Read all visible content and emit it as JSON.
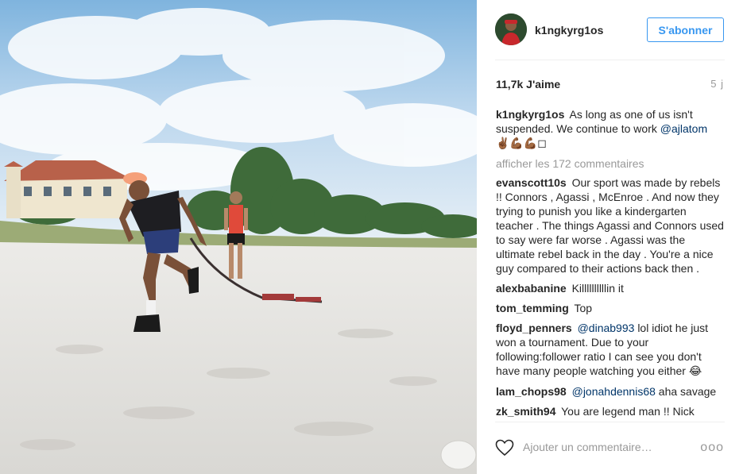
{
  "photo": {
    "alt_icon": "beach-training-photo"
  },
  "header": {
    "username": "k1ngkyrg1os",
    "follow_label": "S'abonner",
    "avatar_icon": "avatar"
  },
  "stats": {
    "likes": "11,7k J'aime",
    "age": "5 j"
  },
  "caption": {
    "author": "k1ngkyrg1os",
    "text": "As long as one of us isn't suspended. We continue to work",
    "mention": "@ajlatom",
    "emojis": "✌🏾💪🏾💪🏾◻"
  },
  "load_more": "afficher les 172 commentaires",
  "comments": [
    {
      "author": "evanscott10s",
      "pre": "",
      "mention": "",
      "text": "Our sport was made by rebels !! Connors , Agassi , McEnroe . And now they trying to punish you like a kindergarten teacher . The things Agassi and Connors used to say were far worse . Agassi was the ultimate rebel back in the day . You're a nice guy compared to their actions back then .",
      "emoji": ""
    },
    {
      "author": "alexbabanine",
      "pre": "",
      "mention": "",
      "text": "Killllllllllin it",
      "emoji": ""
    },
    {
      "author": "tom_temming",
      "pre": "",
      "mention": "",
      "text": "Top",
      "emoji": ""
    },
    {
      "author": "floyd_penners",
      "pre": "",
      "mention": "@dinab993",
      "text": "lol idiot he just won a tournament. Due to your following:follower ratio I can see you don't have many people watching you either",
      "emoji": "😂"
    },
    {
      "author": "lam_chops98",
      "pre": "",
      "mention": "@jonahdennis68",
      "text": "aha savage",
      "emoji": ""
    },
    {
      "author": "zk_smith94",
      "pre": "",
      "mention": "",
      "text": "You are legend man !! Nick",
      "emoji": ""
    }
  ],
  "footer": {
    "comment_placeholder": "Ajouter un commentaire…",
    "more_label": "ooo",
    "heart_icon": "heart-icon"
  },
  "colors": {
    "accent": "#3897f0",
    "mention": "#003569",
    "muted": "#999999"
  }
}
